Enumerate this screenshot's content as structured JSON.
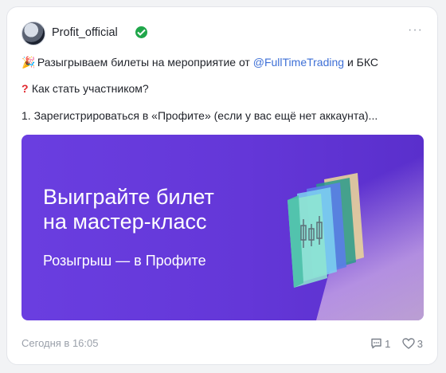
{
  "post": {
    "author": "Profit_official",
    "line1_prefix": "Разыгрываем билеты на мероприятие от ",
    "line1_mention": "@FullTimeTrading",
    "line1_suffix": " и БКС",
    "line2": "Как стать участником?",
    "line3": "1. Зарегистрироваться в «Профите» (если у вас ещё нет аккаунта)...",
    "banner_title_1": "Выиграйте билет",
    "banner_title_2": "на мастер-класс",
    "banner_subtitle": "Розыгрыш — в Профите",
    "date": "Сегодня в 16:05",
    "comments_count": "1",
    "likes_count": "3"
  },
  "icons": {
    "party": "party-popper-icon",
    "question": "red-question-mark-icon",
    "verified": "verified-check-icon",
    "more": "more-dots-icon",
    "comment": "comment-icon",
    "like": "heart-icon"
  },
  "colors": {
    "mention": "#3d6fd6",
    "banner": "#6437d8",
    "verified": "#1fa64a"
  }
}
